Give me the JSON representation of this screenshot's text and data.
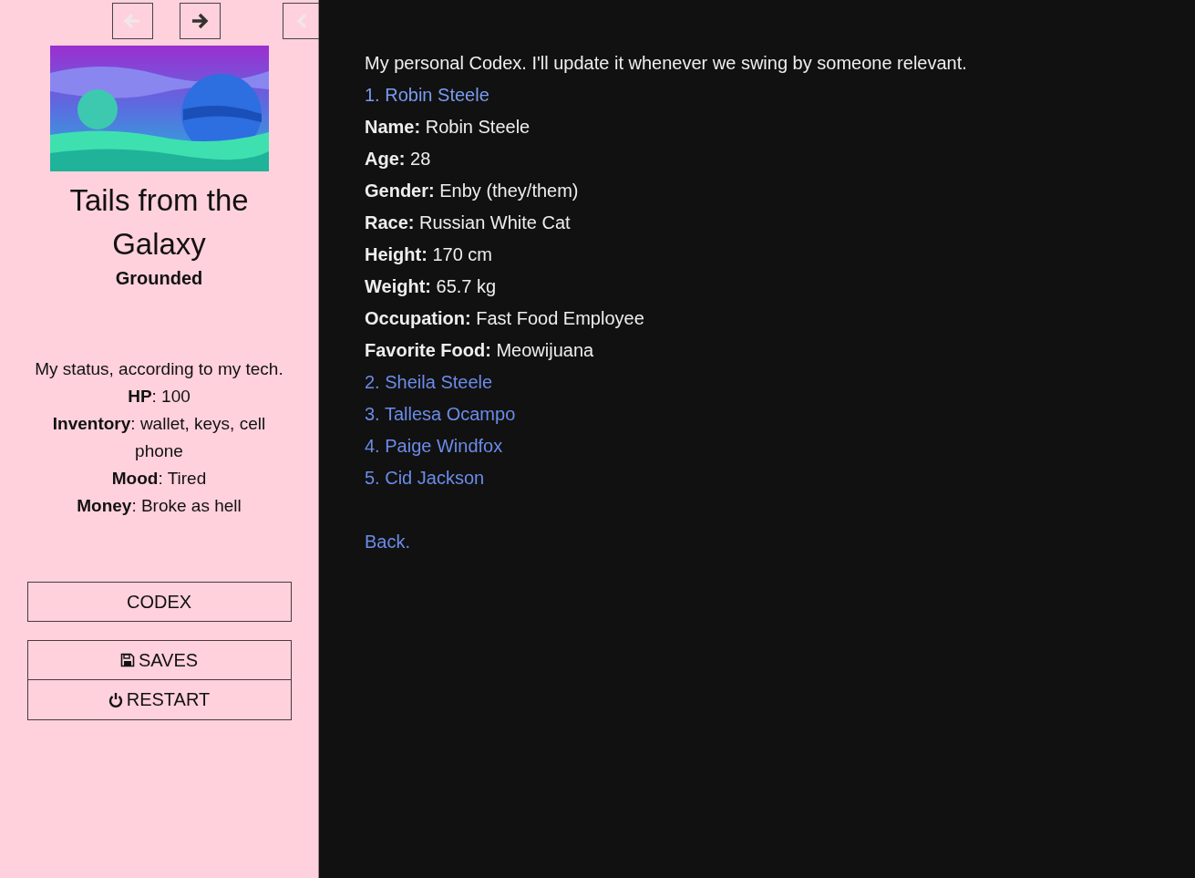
{
  "nav": {
    "back": {
      "disabled": true
    },
    "forward": {
      "disabled": false
    },
    "collapse": {
      "disabled": true
    }
  },
  "story": {
    "title": "Tails from the Galaxy",
    "subtitle": "Grounded"
  },
  "status": {
    "intro": "My status, according to my tech.",
    "lines": [
      "**HP**: 100",
      "**Inventory**: wallet, keys, cell phone",
      "**Mood**: Tired",
      "**Money**: Broke as hell"
    ]
  },
  "menu": [
    {
      "kind": "plain",
      "label": "CODEX"
    },
    {
      "kind": "saves",
      "label": "SAVES"
    },
    {
      "kind": "restart",
      "label": "RESTART"
    }
  ],
  "passage": {
    "intro": "My personal Codex. I'll update it whenever we swing by someone relevant.",
    "entries": [
      {
        "link": "1. Robin Steele",
        "expanded": true,
        "fields": [
          "**Name:** Robin Steele",
          "**Age:** 28",
          "**Gender:** Enby (they/them)",
          "**Race:** Russian White Cat",
          "**Height:** 170 cm",
          "**Weight:** 65.7 kg",
          "**Occupation:** Fast Food Employee",
          "**Favorite Food:** Meowijuana"
        ]
      },
      {
        "link": "2. Sheila Steele",
        "expanded": false
      },
      {
        "link": "3. Tallesa Ocampo",
        "expanded": false
      },
      {
        "link": "4. Paige Windfox",
        "expanded": false
      },
      {
        "link": "5. Cid Jackson",
        "expanded": false
      }
    ],
    "back": "Back."
  }
}
